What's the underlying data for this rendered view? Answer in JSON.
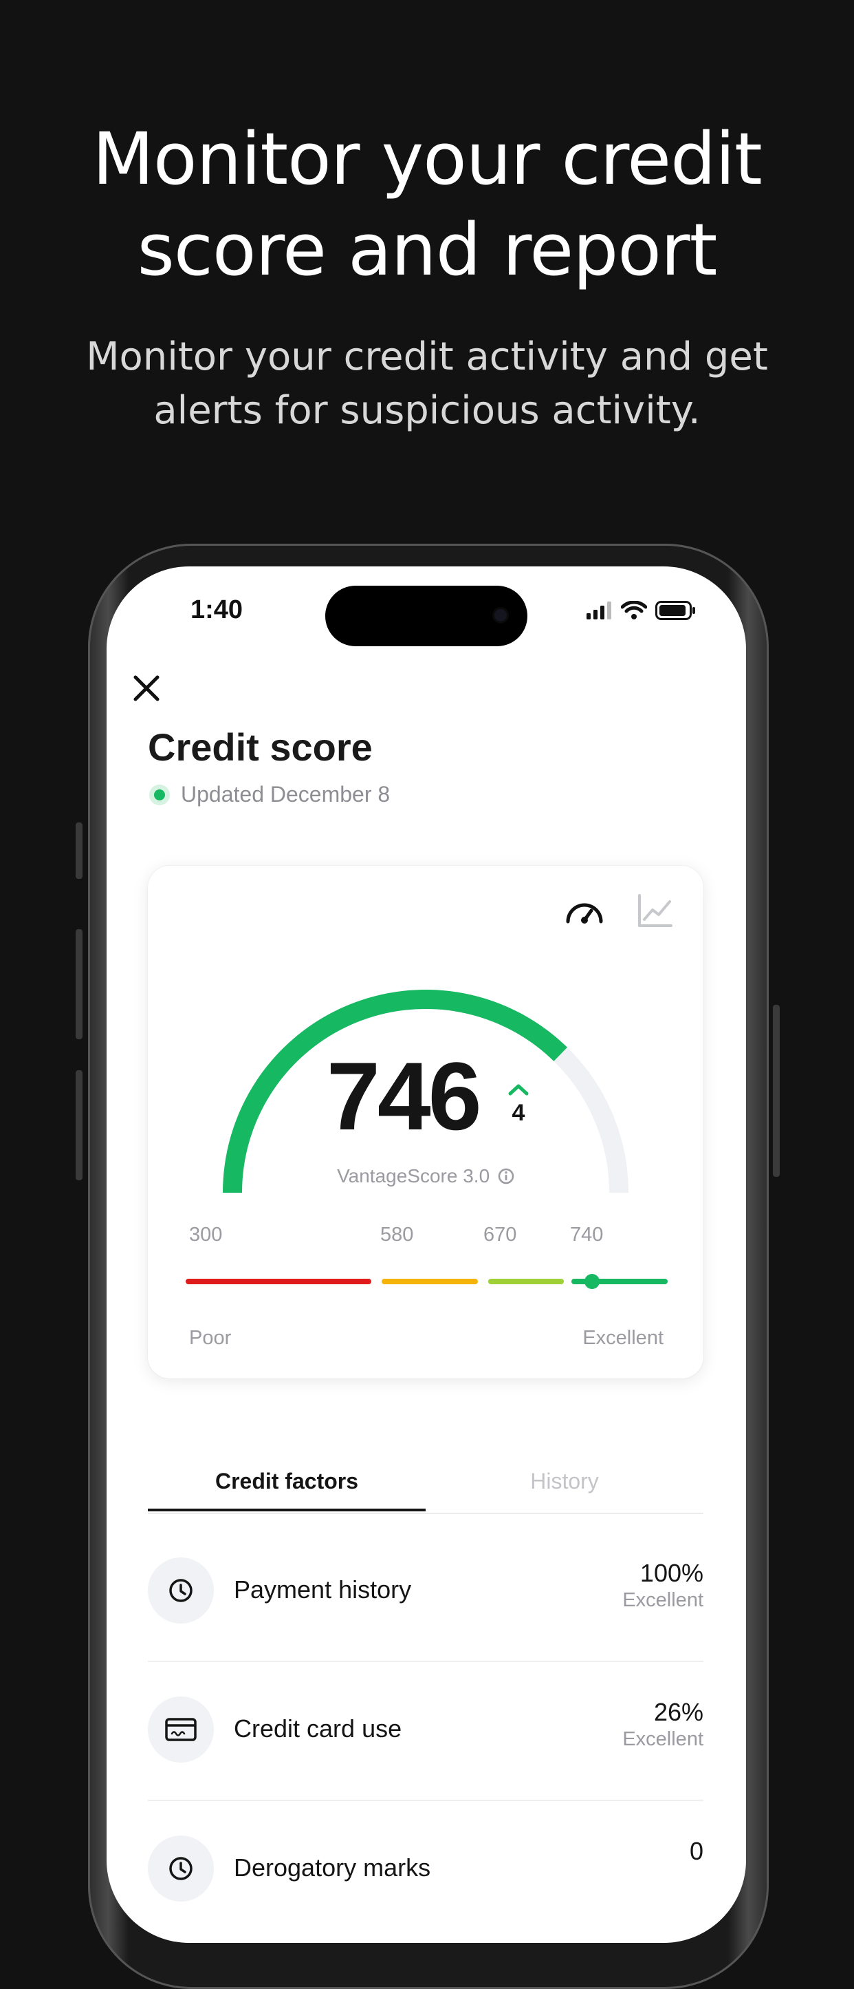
{
  "hero": {
    "title_line1": "Monitor your credit",
    "title_line2": "score and report",
    "subtitle_line1": "Monitor your credit activity and get",
    "subtitle_line2": "alerts for suspicious activity."
  },
  "status_bar": {
    "time": "1:40"
  },
  "header": {
    "title": "Credit score",
    "updated": "Updated December 8"
  },
  "score_card": {
    "score": "746",
    "change": "4",
    "model": "VantageScore 3.0",
    "gauge_fraction": 0.746,
    "ticks": [
      "300",
      "580",
      "670",
      "740"
    ],
    "low_label": "Poor",
    "high_label": "Excellent",
    "colors": {
      "poor": "#e01b1b",
      "fair": "#f5b40a",
      "good": "#9fd035",
      "excellent": "#16b862",
      "track": "#f0f1f4"
    }
  },
  "tabs": [
    {
      "label": "Credit factors",
      "active": true
    },
    {
      "label": "History",
      "active": false
    }
  ],
  "factors": [
    {
      "icon": "clock-icon",
      "label": "Payment history",
      "value": "100%",
      "rating": "Excellent"
    },
    {
      "icon": "credit-card-icon",
      "label": "Credit card use",
      "value": "26%",
      "rating": "Excellent"
    },
    {
      "icon": "clock-icon",
      "label": "Derogatory marks",
      "value": "0",
      "rating": ""
    }
  ]
}
